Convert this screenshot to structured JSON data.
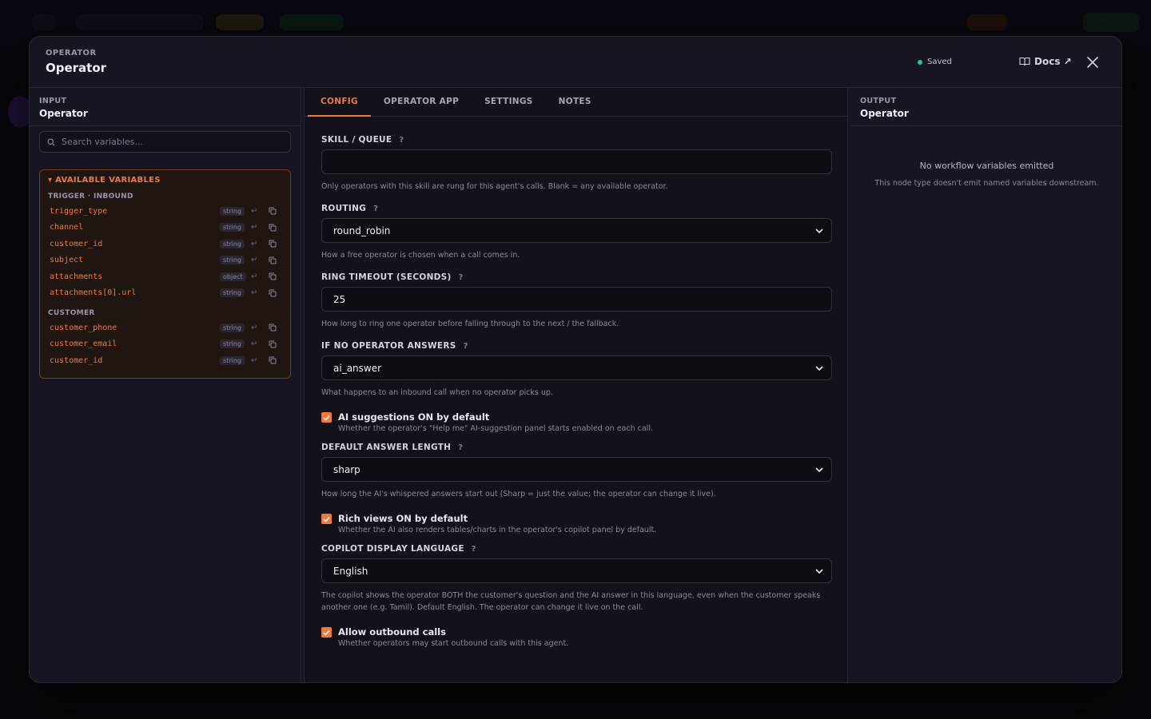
{
  "modal": {
    "eyebrow": "OPERATOR",
    "title": "Operator",
    "status": "Saved",
    "status_color": "#2bc48a",
    "docs_label": "Docs ↗"
  },
  "input_panel": {
    "eyebrow": "INPUT",
    "name": "Operator",
    "search_placeholder": "Search variables...",
    "vars_title": "▾ AVAILABLE VARIABLES",
    "groups": [
      {
        "label": "TRIGGER · INBOUND",
        "vars": [
          {
            "name": "trigger_type",
            "type": "string"
          },
          {
            "name": "channel",
            "type": "string"
          },
          {
            "name": "customer_id",
            "type": "string"
          },
          {
            "name": "subject",
            "type": "string"
          },
          {
            "name": "attachments",
            "type": "object"
          },
          {
            "name": "attachments[0].url",
            "type": "string"
          }
        ]
      },
      {
        "label": "CUSTOMER",
        "vars": [
          {
            "name": "customer_phone",
            "type": "string"
          },
          {
            "name": "customer_email",
            "type": "string"
          },
          {
            "name": "customer_id",
            "type": "string"
          }
        ]
      }
    ]
  },
  "tabs": [
    "CONFIG",
    "OPERATOR APP",
    "SETTINGS",
    "NOTES"
  ],
  "config": {
    "skill": {
      "label": "SKILL / QUEUE",
      "value": "",
      "hint": "Only operators with this skill are rung for this agent's calls. Blank = any available operator."
    },
    "routing": {
      "label": "ROUTING",
      "value": "round_robin",
      "hint": "How a free operator is chosen when a call comes in."
    },
    "ring_timeout": {
      "label": "RING TIMEOUT (SECONDS)",
      "value": "25",
      "hint": "How long to ring one operator before falling through to the next / the fallback."
    },
    "no_answer": {
      "label": "IF NO OPERATOR ANSWERS",
      "value": "ai_answer",
      "hint": "What happens to an inbound call when no operator picks up."
    },
    "ai_suggestions": {
      "label": "AI suggestions ON by default",
      "hint": "Whether the operator's \"Help me\" AI-suggestion panel starts enabled on each call.",
      "checked": true
    },
    "answer_length": {
      "label": "DEFAULT ANSWER LENGTH",
      "value": "sharp",
      "hint": "How long the AI's whispered answers start out (Sharp = just the value; the operator can change it live)."
    },
    "rich_views": {
      "label": "Rich views ON by default",
      "hint": "Whether the AI also renders tables/charts in the operator's copilot panel by default.",
      "checked": true
    },
    "display_language": {
      "label": "COPILOT DISPLAY LANGUAGE",
      "value": "English",
      "hint": "The copilot shows the operator BOTH the customer's question and the AI answer in this language, even when the customer speaks another one (e.g. Tamil). Default English. The operator can change it live on the call."
    },
    "outbound": {
      "label": "Allow outbound calls",
      "hint": "Whether operators may start outbound calls with this agent.",
      "checked": true
    }
  },
  "output_panel": {
    "eyebrow": "OUTPUT",
    "name": "Operator",
    "empty_title": "No workflow variables emitted",
    "empty_sub": "This node type doesn't emit named variables downstream."
  },
  "accent": "#f07a3e"
}
